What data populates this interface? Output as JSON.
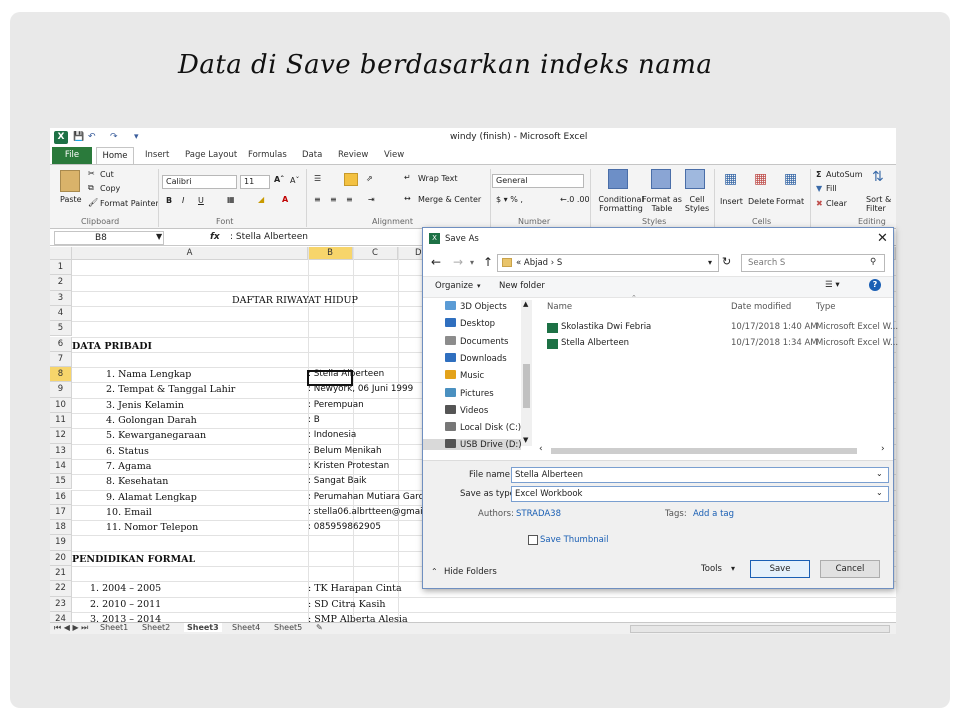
{
  "slide_title": "Data di Save berdasarkan indeks nama",
  "excel": {
    "window_title": "windy (finish)  -  Microsoft Excel",
    "tabs": [
      "Home",
      "Insert",
      "Page Layout",
      "Formulas",
      "Data",
      "Review",
      "View"
    ],
    "file_tab": "File",
    "ribbon": {
      "paste": "Paste",
      "cut": "Cut",
      "copy": "Copy",
      "format_painter": "Format Painter",
      "clipboard": "Clipboard",
      "font_name": "Calibri",
      "font_size": "11",
      "font_group": "Font",
      "wrap_text": "Wrap Text",
      "merge_center": "Merge & Center",
      "alignment_group": "Alignment",
      "number_format": "General",
      "number_group": "Number",
      "conditional_formatting": "Conditional Formatting",
      "format_as_table": "Format as Table",
      "cell_styles": "Cell Styles",
      "styles_group": "Styles",
      "insert": "Insert",
      "delete": "Delete",
      "format": "Format",
      "cells_group": "Cells",
      "autosum": "AutoSum",
      "fill": "Fill",
      "clear": "Clear",
      "sort_filter": "Sort & Filter",
      "editing_group": "Editing"
    },
    "name_box": "B8",
    "formula": ": Stella Alberteen",
    "columns": [
      "A",
      "B",
      "C",
      "D"
    ],
    "rows": [
      "1",
      "2",
      "3",
      "4",
      "5",
      "6",
      "7",
      "8",
      "9",
      "10",
      "11",
      "12",
      "13",
      "14",
      "15",
      "16",
      "17",
      "18",
      "19",
      "20",
      "21",
      "22",
      "23",
      "24"
    ],
    "cells": {
      "r3": "DAFTAR RIWAYAT HIDUP",
      "r6": "DATA PRIBADI",
      "r20": "PENDIDIKAN FORMAL",
      "labels": [
        "1.  Nama Lengkap",
        "2.  Tempat & Tanggal Lahir",
        "3.  Jenis Kelamin",
        "4.  Golongan Darah",
        "5.  Kewarganegaraan",
        "6.  Status",
        "7.  Agama",
        "8.  Kesehatan",
        "9.  Alamat Lengkap",
        "10. Email",
        "11. Nomor Telepon"
      ],
      "values": [
        ": Stella Alberteen",
        ": Newyork, 06 Juni 1999",
        ": Perempuan",
        ": B",
        ": Indonesia",
        ": Belum Menikah",
        ": Kristen Protestan",
        ": Sangat Baik",
        ": Perumahan Mutiara Gard",
        ": stella06.albrtteen@gmai",
        ": 085959862905"
      ],
      "edu_labels": [
        "1. 2004 – 2005",
        "2. 2010 – 2011",
        "3. 2013 – 2014"
      ],
      "edu_values": [
        ": TK Harapan Cinta",
        ": SD Citra Kasih",
        ": SMP Alberta Alesia"
      ]
    },
    "sheets": [
      "Sheet1",
      "Sheet2",
      "Sheet3",
      "Sheet4",
      "Sheet5"
    ]
  },
  "dialog": {
    "title": "Save As",
    "path": "«  Abjad  ›  S",
    "search_placeholder": "Search S",
    "organize": "Organize",
    "new_folder": "New folder",
    "nav_items": [
      "3D Objects",
      "Desktop",
      "Documents",
      "Downloads",
      "Music",
      "Pictures",
      "Videos",
      "Local Disk (C:)",
      "USB Drive (D:)"
    ],
    "col_name": "Name",
    "col_date": "Date modified",
    "col_type": "Type",
    "files": [
      {
        "name": "Skolastika Dwi Febria",
        "date": "10/17/2018 1:40 AM",
        "type": "Microsoft Excel W..."
      },
      {
        "name": "Stella Alberteen",
        "date": "10/17/2018 1:34 AM",
        "type": "Microsoft Excel W..."
      }
    ],
    "file_name_label": "File name:",
    "file_name_value": "Stella Alberteen",
    "save_type_label": "Save as type:",
    "save_type_value": "Excel Workbook",
    "authors_label": "Authors:",
    "authors_value": "STRADA38",
    "tags_label": "Tags:",
    "tags_value": "Add a tag",
    "save_thumbnail": "Save Thumbnail",
    "hide_folders": "Hide Folders",
    "tools": "Tools",
    "save": "Save",
    "cancel": "Cancel"
  }
}
